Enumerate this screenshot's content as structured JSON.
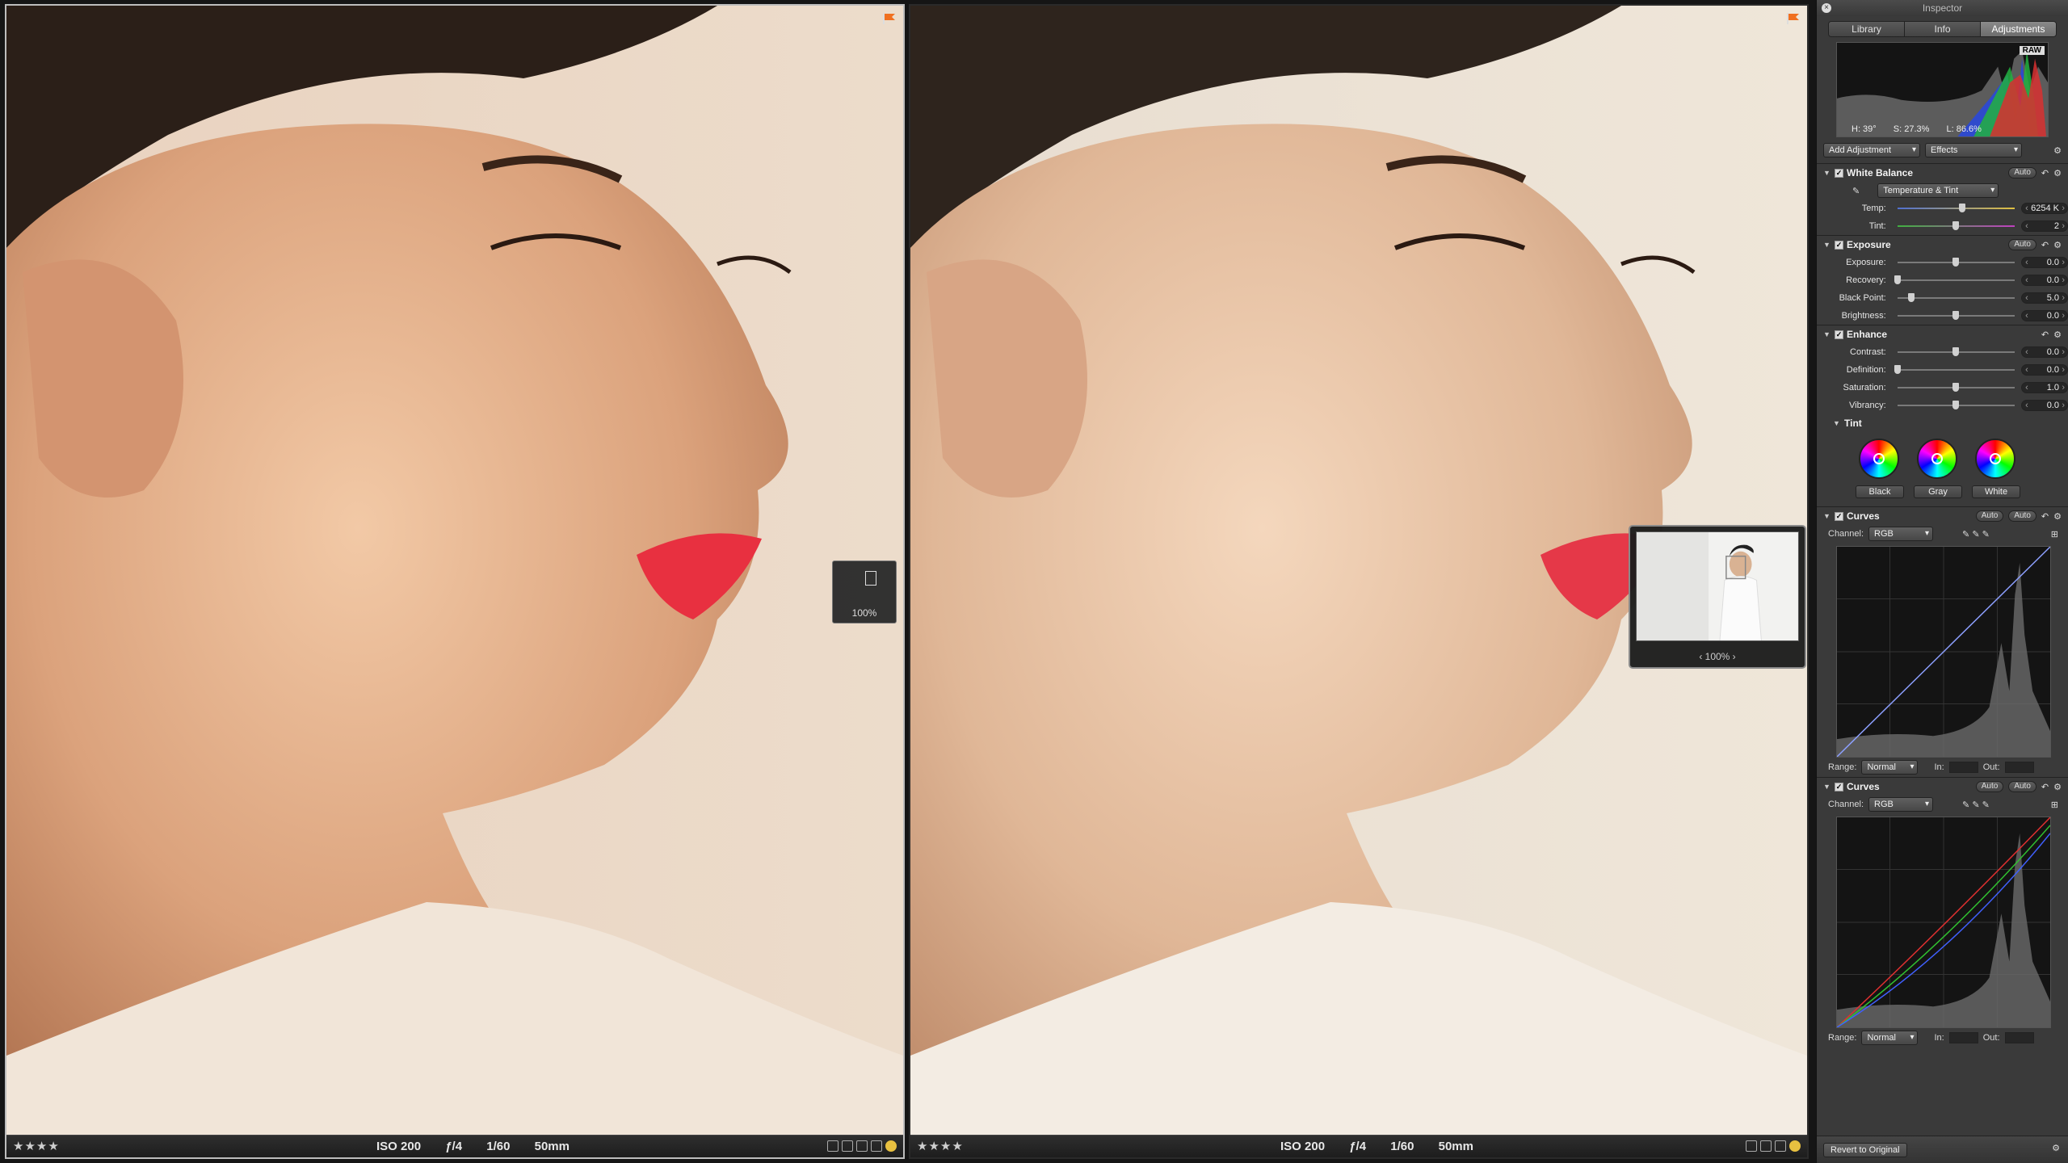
{
  "viewers": [
    {
      "rating": "★★★★",
      "iso": "ISO 200",
      "aperture": "ƒ/4",
      "shutter": "1/60",
      "focal": "50mm"
    },
    {
      "rating": "★★★★",
      "iso": "ISO 200",
      "aperture": "ƒ/4",
      "shutter": "1/60",
      "focal": "50mm"
    }
  ],
  "loupe_small": {
    "zoom": "100%"
  },
  "loupe_nav": {
    "zoom": "‹   100%   ›"
  },
  "inspector": {
    "title": "Inspector",
    "tabs": [
      "Library",
      "Info",
      "Adjustments"
    ],
    "active_tab": "Adjustments",
    "raw_badge": "RAW",
    "histogram_readout": {
      "h": "H: 39°",
      "s": "S: 27.3%",
      "l": "L: 86.6%"
    },
    "add_adjustment": "Add Adjustment",
    "effects": "Effects",
    "white_balance": {
      "title": "White Balance",
      "auto": "Auto",
      "mode": "Temperature & Tint",
      "temp_label": "Temp:",
      "temp_value": "6254 K",
      "temp_pos": 0.55,
      "tint_label": "Tint:",
      "tint_value": "2",
      "tint_pos": 0.5
    },
    "exposure": {
      "title": "Exposure",
      "auto": "Auto",
      "rows": [
        {
          "label": "Exposure:",
          "value": "0.0",
          "pos": 0.5
        },
        {
          "label": "Recovery:",
          "value": "0.0",
          "pos": 0.0
        },
        {
          "label": "Black Point:",
          "value": "5.0",
          "pos": 0.12
        },
        {
          "label": "Brightness:",
          "value": "0.0",
          "pos": 0.5
        }
      ]
    },
    "enhance": {
      "title": "Enhance",
      "rows": [
        {
          "label": "Contrast:",
          "value": "0.0",
          "pos": 0.5
        },
        {
          "label": "Definition:",
          "value": "0.0",
          "pos": 0.0
        },
        {
          "label": "Saturation:",
          "value": "1.0",
          "pos": 0.5
        },
        {
          "label": "Vibrancy:",
          "value": "0.0",
          "pos": 0.5
        }
      ],
      "tint_title": "Tint",
      "wheels": [
        "Black",
        "Gray",
        "White"
      ]
    },
    "curves": [
      {
        "title": "Curves",
        "auto1": "Auto",
        "auto2": "Auto",
        "channel_label": "Channel:",
        "channel": "RGB",
        "range_label": "Range:",
        "range": "Normal",
        "in_label": "In:",
        "out_label": "Out:"
      },
      {
        "title": "Curves",
        "auto1": "Auto",
        "auto2": "Auto",
        "channel_label": "Channel:",
        "channel": "RGB",
        "range_label": "Range:",
        "range": "Normal",
        "in_label": "In:",
        "out_label": "Out:"
      }
    ],
    "revert": "Revert to Original"
  }
}
